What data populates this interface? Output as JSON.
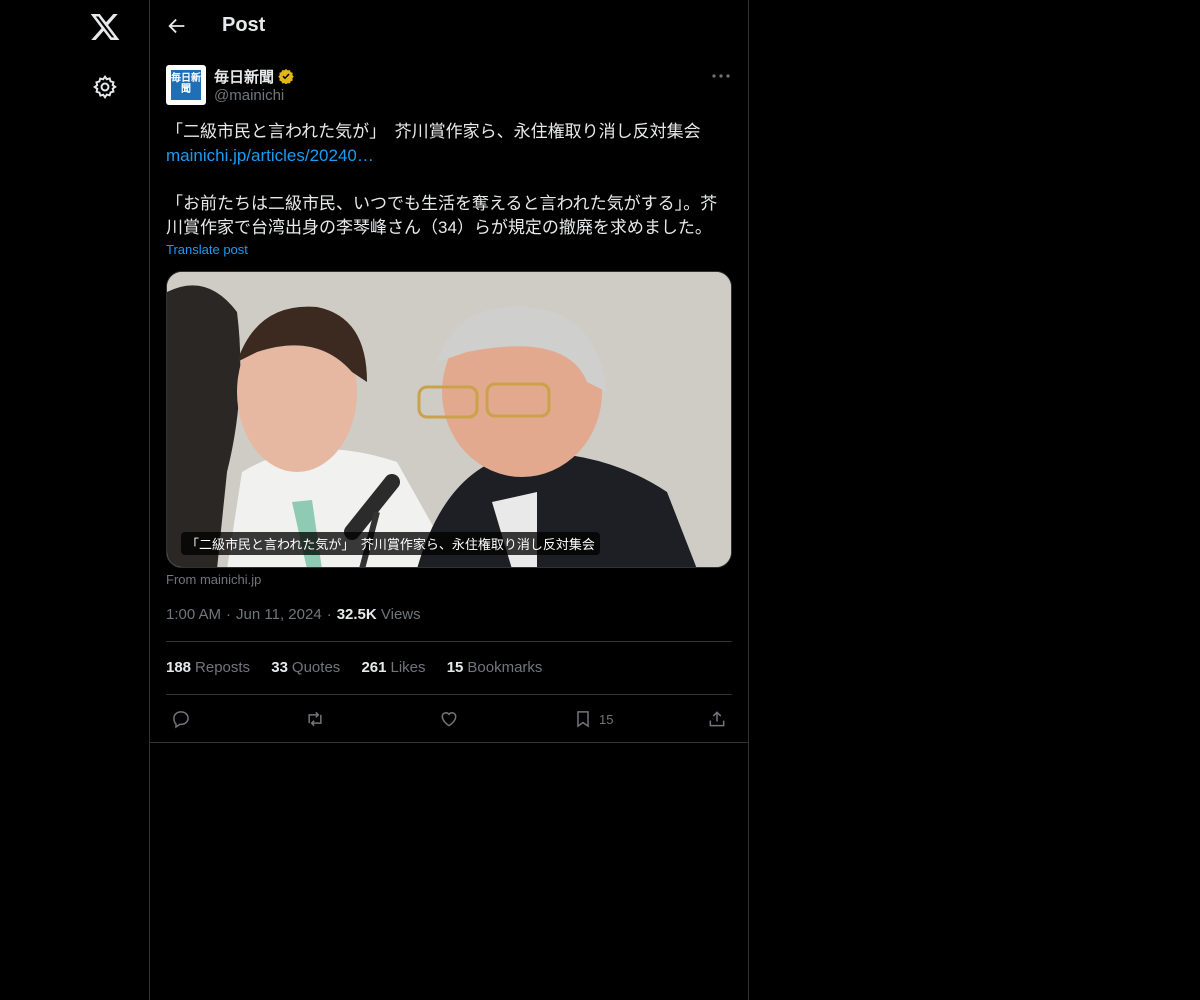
{
  "header": {
    "title": "Post"
  },
  "author": {
    "display_name": "毎日新聞",
    "handle": "@mainichi",
    "avatar_text": "毎日新聞"
  },
  "post": {
    "line1": "「二級市民と言われた気が」　芥川賞作家ら、永住権取り消し反対集会",
    "link": "mainichi.jp/articles/20240…",
    "body": "「お前たちは二級市民、いつでも生活を奪えると言われた気がする」。芥川賞作家で台湾出身の李琴峰さん（34）らが規定の撤廃を求めました。",
    "translate": "Translate post",
    "media_caption": "「二級市民と言われた気が」　芥川賞作家ら、永住権取り消し反対集会",
    "source": "From mainichi.jp"
  },
  "meta": {
    "time": "1:00 AM",
    "date": "Jun 11, 2024",
    "views_count": "32.5K",
    "views_label": "Views",
    "separator": "·"
  },
  "stats": {
    "reposts_count": "188",
    "reposts_label": "Reposts",
    "quotes_count": "33",
    "quotes_label": "Quotes",
    "likes_count": "261",
    "likes_label": "Likes",
    "bookmarks_count": "15",
    "bookmarks_label": "Bookmarks"
  },
  "actions": {
    "bookmark_count": "15"
  },
  "colors": {
    "accent": "#1d9bf0",
    "verified": "#e2b719",
    "muted": "#71767b",
    "border": "#2f3336"
  }
}
